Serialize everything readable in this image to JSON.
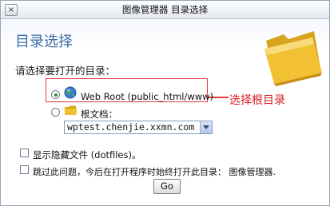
{
  "window": {
    "title": "图像管理器 目录选择",
    "close_glyph": "×"
  },
  "heading": "目录选择",
  "prompt": "请选择要打开的目录：",
  "options": {
    "web_root_label": "Web Root (public_html/www)",
    "home_label": "根文档：",
    "domain_selected": "wptest.chenjie.xxmn.com"
  },
  "annotation": "选择根目录",
  "checkboxes": {
    "hidden_files_label": "显示隐藏文件 (dotfiles)。",
    "skip_label": "跳过此问题，今后在打开程序时始终打开此目录： 图像管理器."
  },
  "go_label": "Go",
  "colors": {
    "heading": "#3d6aa3",
    "annotation": "#d92020",
    "highlight_border": "#e23a3a",
    "folder": "#f2c033"
  },
  "icons": {
    "close": "close-icon",
    "large_folder": "folder-icon",
    "web_root": "globe-icon",
    "home": "folder-icon",
    "dropdown": "chevron-down-icon"
  }
}
